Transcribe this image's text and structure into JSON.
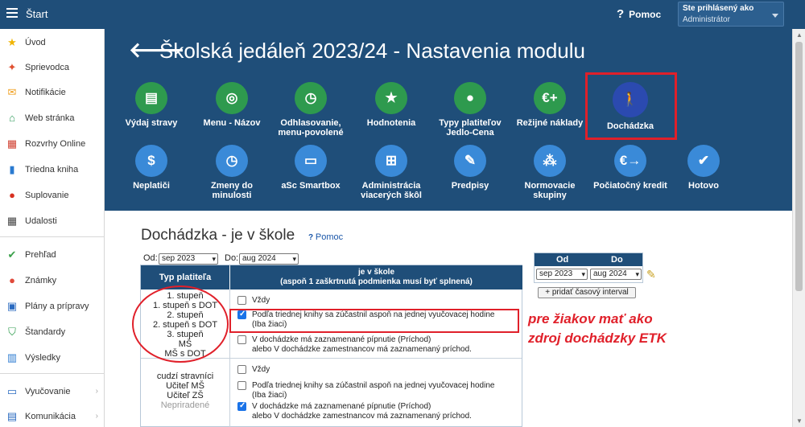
{
  "topbar": {
    "start": "Štart",
    "help": "Pomoc",
    "user_label": "Ste prihlásený ako",
    "user_name": "Administrátor"
  },
  "sidebar": {
    "items": [
      {
        "label": "Úvod",
        "icon": "star-icon",
        "color": "#f0b400"
      },
      {
        "label": "Sprievodca",
        "icon": "wand-icon",
        "color": "#e05030"
      },
      {
        "label": "Notifikácie",
        "icon": "envelope-icon",
        "color": "#f0a020"
      },
      {
        "label": "Web stránka",
        "icon": "house-icon",
        "color": "#2e9a5a"
      },
      {
        "label": "Rozvrhy Online",
        "icon": "calendar-icon",
        "color": "#d04030"
      },
      {
        "label": "Triedna kniha",
        "icon": "book-icon",
        "color": "#2a7ad0"
      },
      {
        "label": "Suplovanie",
        "icon": "person-icon",
        "color": "#d83020"
      },
      {
        "label": "Udalosti",
        "icon": "calendar-dark-icon",
        "color": "#444"
      },
      {
        "label": "Prehľad",
        "icon": "check-circle-icon",
        "color": "#3aa04a"
      },
      {
        "label": "Známky",
        "icon": "grade-icon",
        "color": "#e04a3a"
      },
      {
        "label": "Plány a prípravy",
        "icon": "briefcase-icon",
        "color": "#2a6ac0"
      },
      {
        "label": "Štandardy",
        "icon": "shield-icon",
        "color": "#2a9a4a"
      },
      {
        "label": "Výsledky",
        "icon": "bar-chart-icon",
        "color": "#2a7ad0"
      },
      {
        "label": "Vyučovanie",
        "icon": "monitor-icon",
        "color": "#2a6ac0"
      },
      {
        "label": "Komunikácia",
        "icon": "chat-icon",
        "color": "#2a6ac0"
      }
    ]
  },
  "header": {
    "title": "Školská jedáleň 2023/24 - Nastavenia modulu",
    "tiles_row1": [
      {
        "label": "Výdaj stravy",
        "icon": "open-sign-icon",
        "color": "#2e9a4e"
      },
      {
        "label": "Menu - Názov",
        "icon": "abc-icon",
        "color": "#2e9a4e"
      },
      {
        "label": "Odhlasovanie, menu-povolené",
        "icon": "clock-icon",
        "color": "#2e9a4e"
      },
      {
        "label": "Hodnotenia",
        "icon": "star-icon",
        "color": "#2e9a4e"
      },
      {
        "label": "Typy platiteľov Jedlo-Cena",
        "icon": "person-icon",
        "color": "#2e9a4e"
      },
      {
        "label": "Režijné náklady",
        "icon": "euro-plus-icon",
        "color": "#2e9a4e"
      },
      {
        "label": "Dochádzka",
        "icon": "walking-icon",
        "color": "#2b4ab0"
      }
    ],
    "tiles_row2": [
      {
        "label": "Neplatiči",
        "icon": "moneybag-icon",
        "color": "#3a8ad8"
      },
      {
        "label": "Zmeny do minulosti",
        "icon": "clock-history-icon",
        "color": "#3a8ad8"
      },
      {
        "label": "aSc Smartbox",
        "icon": "monitor-icon",
        "color": "#3a8ad8"
      },
      {
        "label": "Administrácia viacerých škôl",
        "icon": "network-icon",
        "color": "#3a8ad8"
      },
      {
        "label": "Predpisy",
        "icon": "document-icon",
        "color": "#3a8ad8"
      },
      {
        "label": "Normovacie skupiny",
        "icon": "dots-icon",
        "color": "#3a8ad8"
      },
      {
        "label": "Počiatočný kredit",
        "icon": "euro-arrow-icon",
        "color": "#3a8ad8"
      },
      {
        "label": "Hotovo",
        "icon": "check-icon",
        "color": "#3a8ad8"
      }
    ]
  },
  "section": {
    "title": "Dochádzka - je v škole",
    "help": "Pomoc",
    "od_label": "Od:",
    "od_value": "sep 2023",
    "do_label": "Do:",
    "do_value": "aug 2024"
  },
  "table": {
    "col1_header": "Typ platiteľa",
    "col2_header_line1": "je v škole",
    "col2_header_line2": "(aspoň 1 zaškrtnutá podmienka musí byť splnená)",
    "group1_types": [
      "1. stupeň",
      "1. stupeň  s DOT",
      "2. stupeň",
      "2. stupeň  s DOT",
      "3. stupeň",
      "MŠ",
      "MŠ s DOT"
    ],
    "group2_types": [
      "cudzí stravníci",
      "Učiteľ MŠ",
      "Učiteľ ZŠ",
      "Nepriradené"
    ],
    "opt_always": "Vždy",
    "opt_book_line1": "Podľa triednej knihy sa zúčastnil aspoň na jednej vyučovacej hodine",
    "opt_book_line2": "(Iba žiaci)",
    "opt_att_line1": "V dochádzke má zaznamenané pípnutie (Príchod)",
    "opt_att_line2": "alebo V dochádzke zamestnancov má zaznamenaný príchod."
  },
  "annotation": {
    "line1": "pre žiakov mať ako",
    "line2": "zdroj dochádzky ETK"
  },
  "interval": {
    "col_od": "Od",
    "col_do": "Do",
    "od_value": "sep 2023",
    "do_value": "aug 2024",
    "add_button": "+ pridať časový interval"
  }
}
